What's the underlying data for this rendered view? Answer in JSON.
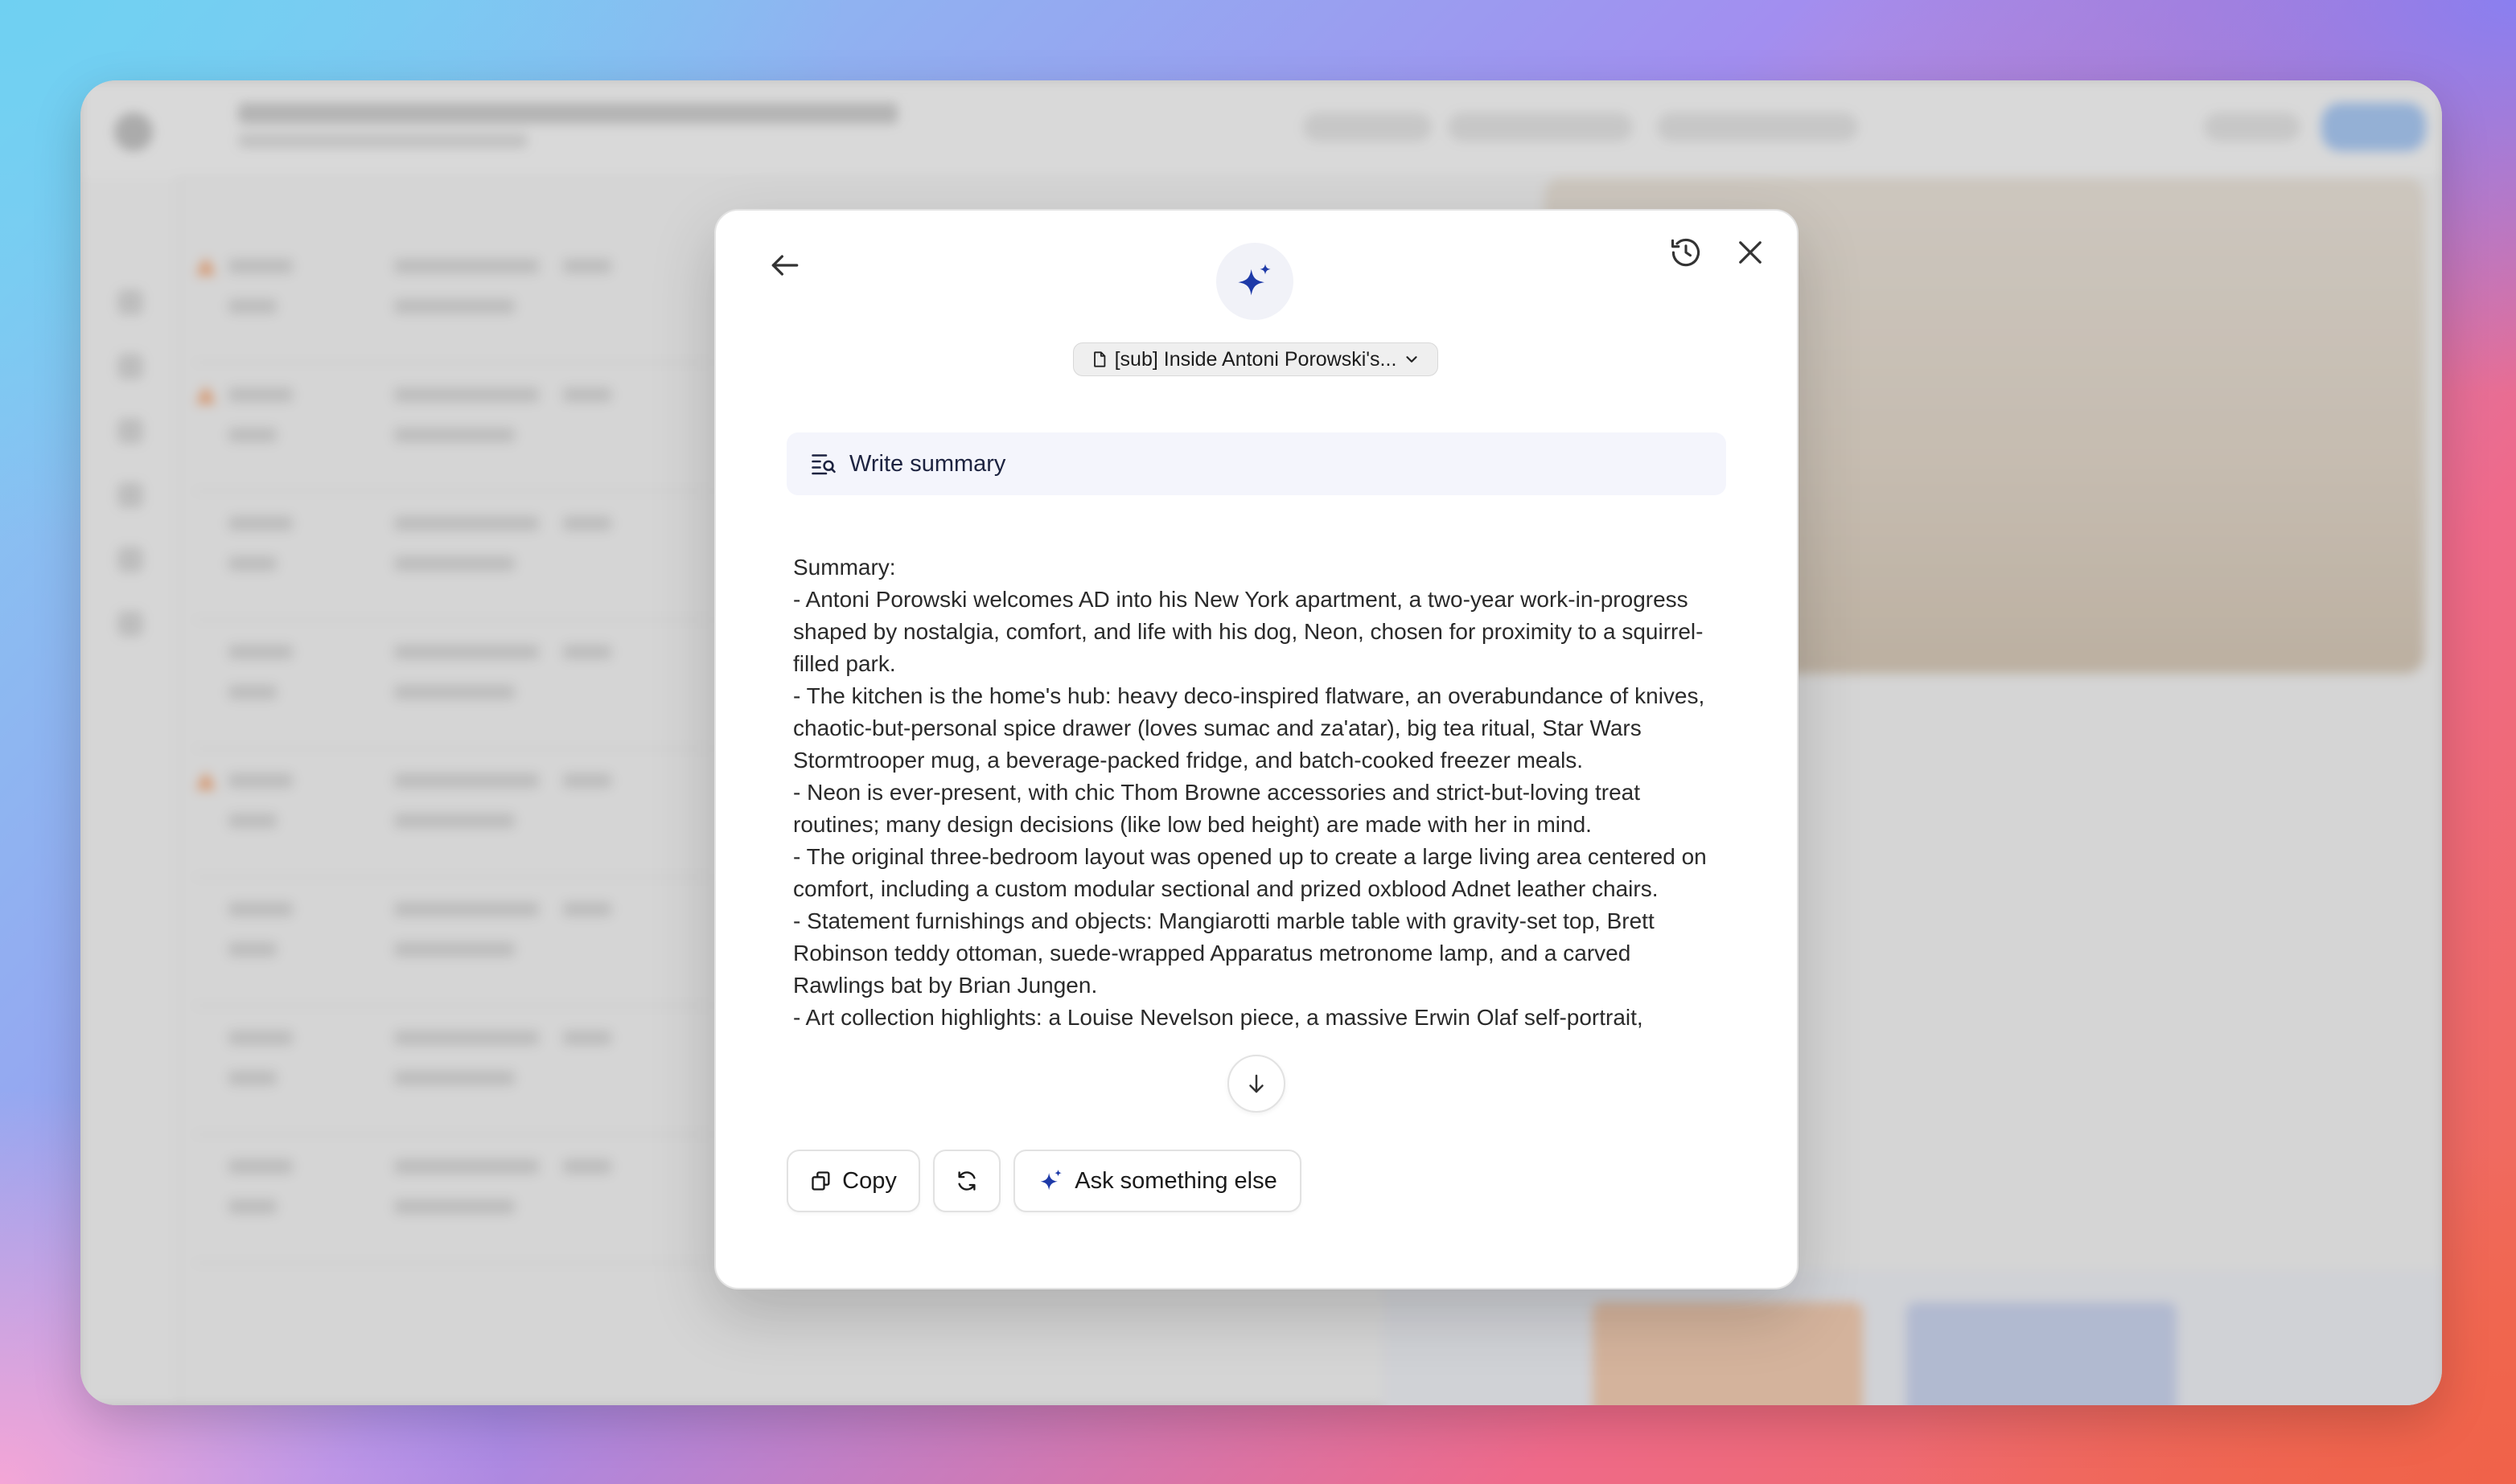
{
  "dialog": {
    "document_chip": {
      "label": "[sub] Inside Antoni Porowski's..."
    },
    "prompt": {
      "label": "Write summary"
    },
    "response": {
      "lines": [
        "Summary:",
        "- Antoni Porowski welcomes AD into his New York apartment, a two-year work-in-progress shaped by nostalgia, comfort, and life with his dog, Neon, chosen for proximity to a squirrel-filled park.",
        "- The kitchen is the home's hub: heavy deco-inspired flatware, an overabundance of knives, chaotic-but-personal spice drawer (loves sumac and za'atar), big tea ritual, Star Wars Stormtrooper mug, a beverage-packed fridge, and batch-cooked freezer meals.",
        "- Neon is ever-present, with chic Thom Browne accessories and strict-but-loving treat routines; many design decisions (like low bed height) are made with her in mind.",
        "- The original three-bedroom layout was opened up to create a large living area centered on comfort, including a custom modular sectional and prized oxblood Adnet leather chairs.",
        "- Statement furnishings and objects: Mangiarotti marble table with gravity-set top, Brett Robinson teddy ottoman, suede-wrapped Apparatus metronome lamp, and a carved Rawlings bat by Brian Jungen.",
        "- Art collection highlights: a Louise Nevelson piece, a massive Erwin Olaf self-portrait,"
      ]
    },
    "actions": {
      "copy_label": "Copy",
      "ask_label": "Ask something else"
    },
    "icons": {
      "back": "arrow-left-icon",
      "history": "history-icon",
      "close": "close-icon",
      "sparkle": "sparkle-icon",
      "document": "document-icon",
      "chevron": "chevron-down-icon",
      "summary": "summary-search-icon",
      "scroll": "arrow-down-icon",
      "copy": "copy-icon",
      "regenerate": "refresh-icon"
    },
    "colors": {
      "accent": "#1e3aa8",
      "prompt_bg": "#f4f5fc"
    }
  }
}
